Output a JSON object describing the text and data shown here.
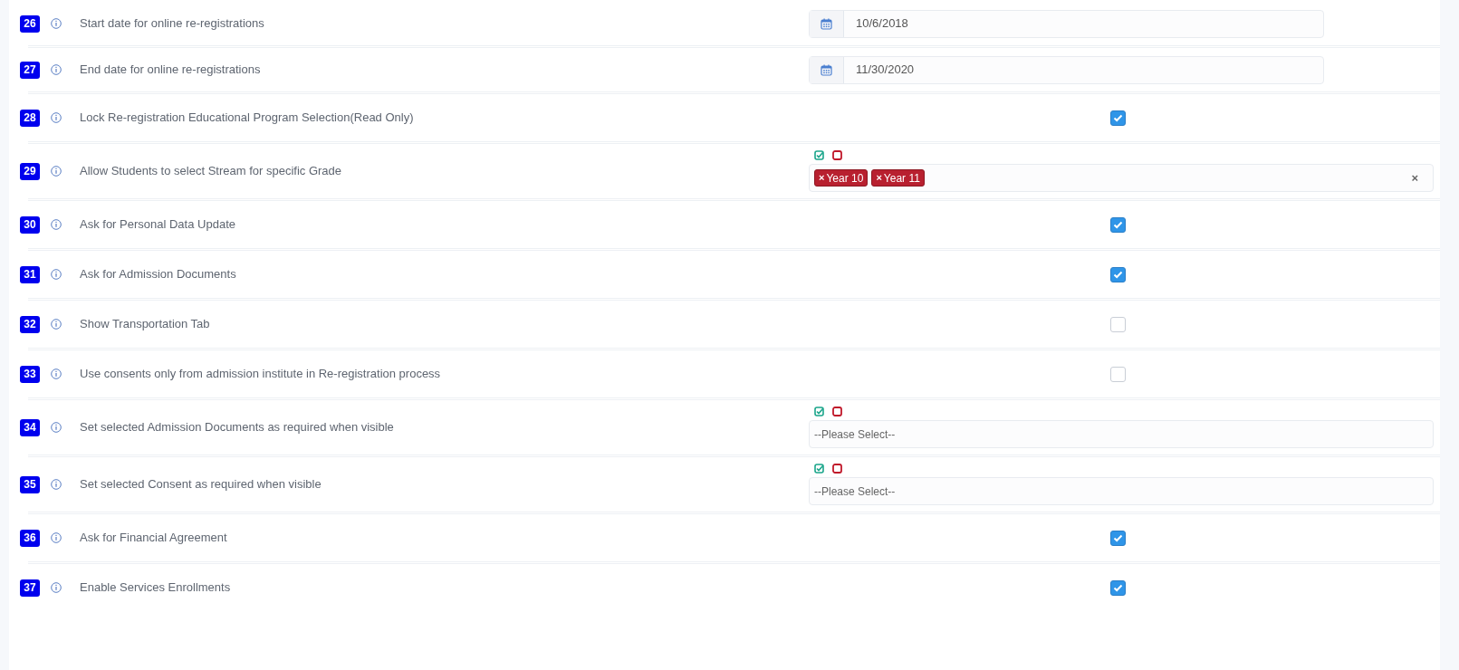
{
  "settings": [
    {
      "number": "26",
      "label": "Start date for online re-registrations",
      "kind": "date",
      "value": "10/6/2018"
    },
    {
      "number": "27",
      "label": "End date for online re-registrations",
      "kind": "date",
      "value": "11/30/2020"
    },
    {
      "number": "28",
      "label": "Lock Re-registration Educational Program Selection(Read Only)",
      "kind": "checkbox",
      "checked": true
    },
    {
      "number": "29",
      "label": "Allow Students to select Stream for specific Grade",
      "kind": "multiselect",
      "tags": [
        {
          "remove": "×",
          "text": "Year 10"
        },
        {
          "remove": "×",
          "text": "Year 11"
        }
      ],
      "clear": "×"
    },
    {
      "number": "30",
      "label": "Ask for Personal Data Update",
      "kind": "checkbox",
      "checked": true
    },
    {
      "number": "31",
      "label": "Ask for Admission Documents",
      "kind": "checkbox",
      "checked": true
    },
    {
      "number": "32",
      "label": "Show Transportation Tab",
      "kind": "checkbox",
      "checked": false
    },
    {
      "number": "33",
      "label": "Use consents only from admission institute in Re-registration process",
      "kind": "checkbox",
      "checked": false
    },
    {
      "number": "34",
      "label": "Set selected Admission Documents as required when visible",
      "kind": "multiselect",
      "placeholder": "--Please Select--"
    },
    {
      "number": "35",
      "label": "Set selected Consent as required when visible",
      "kind": "multiselect",
      "placeholder": "--Please Select--"
    },
    {
      "number": "36",
      "label": "Ask for Financial Agreement",
      "kind": "checkbox",
      "checked": true
    },
    {
      "number": "37",
      "label": "Enable Services Enrollments",
      "kind": "checkbox",
      "checked": true
    }
  ]
}
